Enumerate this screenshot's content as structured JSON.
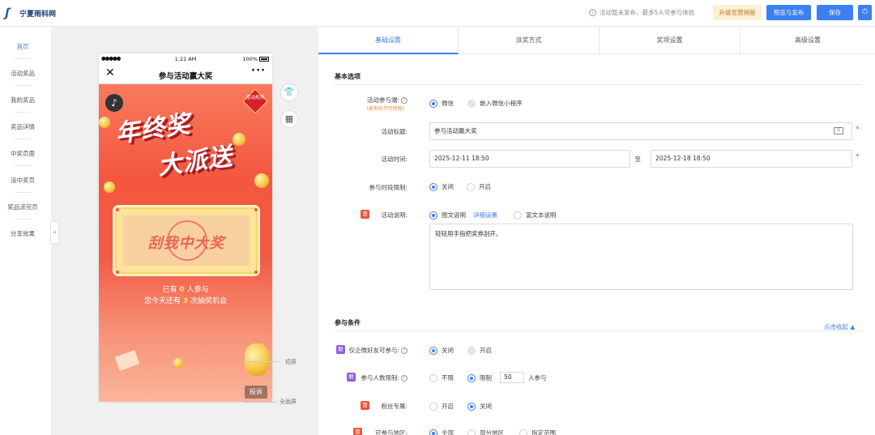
{
  "app": {
    "logo_text": "宁夏雨科网",
    "notice": "活动暂未发布，最多5人可参与体验",
    "upgrade_label": "升级至营销版",
    "preview_publish_label": "预览与发布",
    "save_label": "保存"
  },
  "nav": {
    "items": [
      {
        "label": "首页",
        "active": true
      },
      {
        "label": "活动奖品"
      },
      {
        "label": "我的奖品"
      },
      {
        "label": "奖品详情"
      },
      {
        "label": "中奖页面"
      },
      {
        "label": "没中奖页"
      },
      {
        "label": "奖品派完页"
      },
      {
        "label": "分享效果"
      }
    ],
    "collapse_glyph": "«"
  },
  "phone": {
    "status_left": "●●●●●",
    "status_time": "1:21 AM",
    "status_battery": "100%",
    "title": "参与活动赢大奖",
    "poster": {
      "headline_1": "年终奖",
      "headline_2": "大派送",
      "rules_badge": "活动规则",
      "scratch_text": "刮我中大奖",
      "count_prefix": "已有",
      "count_joined": "0",
      "count_suffix": "人参与",
      "chance_prefix": "您今天还有",
      "chance_count": "3",
      "chance_suffix": "次抽奖机会",
      "complain_label": "投诉"
    }
  },
  "screen_labels": {
    "short": "短屏",
    "full": "全面屏"
  },
  "tabs": [
    "基础设置",
    "派奖方式",
    "奖项设置",
    "高级设置"
  ],
  "basic": {
    "section_title": "基本选项",
    "channel_label": "活动参与端:",
    "channel_note": "(发布后不可修改)",
    "channel_options": [
      "微信",
      "嵌入微信小程序"
    ],
    "title_label": "活动标题:",
    "title_value": "参与活动赢大奖",
    "time_label": "活动时间:",
    "time_start": "2025-12-11 18:50",
    "time_sep": "至",
    "time_end": "2025-12-18 18:50",
    "period_label": "参与时段限制:",
    "period_options": [
      "关闭",
      "开启"
    ],
    "desc_label": "活动说明:",
    "desc_options": [
      "图文说明",
      "富文本说明"
    ],
    "desc_link": "详细设置",
    "desc_text": "轻轻用手指把奖券刮开。"
  },
  "conditions": {
    "section_title": "参与条件",
    "collapse_link": "点击收起",
    "wecom_label": "仅企微好友可参与:",
    "wecom_options": [
      "关闭",
      "开启"
    ],
    "limit_label": "参与人数限制:",
    "limit_options": [
      "不限",
      "限制"
    ],
    "limit_value": "50",
    "limit_unit": "人参与",
    "fans_label": "粉丝专属:",
    "fans_options": [
      "开启",
      "关闭"
    ],
    "region_label": "可参与地区:",
    "region_options": [
      "全部",
      "部分地区",
      "指定范围"
    ]
  },
  "tags": {
    "wecom_tag": "联",
    "red_tag": "营"
  },
  "colors": {
    "accent": "#3c7ff1",
    "upgrade_bg": "#fcefd6",
    "poster_red": "#f4563f"
  }
}
